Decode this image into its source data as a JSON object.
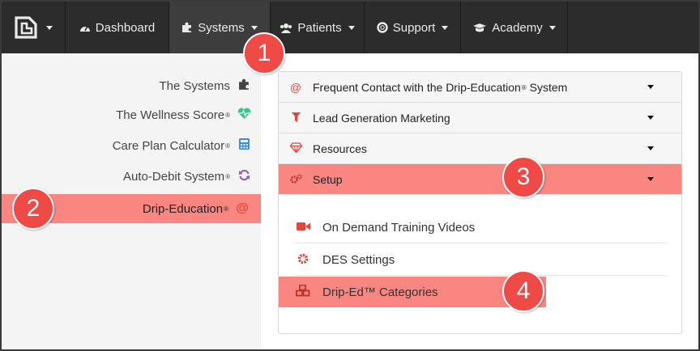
{
  "navbar": {
    "items": [
      {
        "label": "Dashboard",
        "icon": "tachometer-icon"
      },
      {
        "label": "Systems",
        "icon": "puzzle-icon"
      },
      {
        "label": "Patients",
        "icon": "users-icon"
      },
      {
        "label": "Support",
        "icon": "life-ring-icon"
      },
      {
        "label": "Academy",
        "icon": "graduation-cap-icon"
      }
    ]
  },
  "sidebar": {
    "items": [
      {
        "label": "The Systems",
        "mark": "",
        "icon": "puzzle-icon",
        "icon_color": "#444444"
      },
      {
        "label": "The Wellness Score",
        "mark": "®",
        "icon": "heartbeat-icon",
        "icon_color": "#3cc48a"
      },
      {
        "label": "Care Plan Calculator",
        "mark": "®",
        "icon": "calculator-icon",
        "icon_color": "#3a8ee6"
      },
      {
        "label": "Auto-Debit System",
        "mark": "®",
        "icon": "refresh-icon",
        "icon_color": "#9b59b6"
      },
      {
        "label": "Drip-Education",
        "mark": "®",
        "icon": "at-icon",
        "icon_color": "#e2473c"
      }
    ]
  },
  "accordion": {
    "rows": [
      {
        "label": "Frequent Contact with the Drip-Education",
        "mark": "®",
        "label_end": " System",
        "icon": "at-icon"
      },
      {
        "label": "Lead Generation Marketing",
        "mark": "",
        "label_end": "",
        "icon": "filter-icon"
      },
      {
        "label": "Resources",
        "mark": "",
        "label_end": "",
        "icon": "diamond-icon"
      },
      {
        "label": "Setup",
        "mark": "",
        "label_end": "",
        "icon": "cogs-icon"
      }
    ],
    "sub_items": [
      {
        "label": "On Demand Training Videos",
        "icon": "video-camera-icon"
      },
      {
        "label": "DES Settings",
        "icon": "cog-icon"
      },
      {
        "label": "Drip-Ed™ Categories",
        "icon": "cubes-icon"
      }
    ]
  },
  "badges": [
    "1",
    "2",
    "3",
    "4"
  ],
  "colors": {
    "navbar_bg": "#2c2c2c",
    "highlight": "#f98680",
    "badge": "#ef4a45",
    "accent_icon": "#e2473c"
  }
}
